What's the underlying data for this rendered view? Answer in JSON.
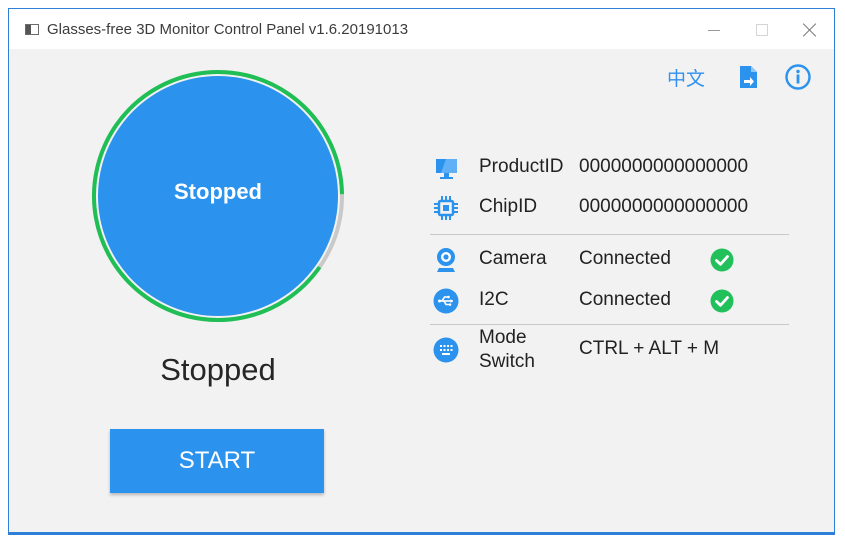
{
  "window": {
    "title": "Glasses-free 3D Monitor Control Panel v1.6.20191013"
  },
  "toolbar": {
    "language_label": "中文",
    "export_icon": "export-icon",
    "info_icon": "info-icon"
  },
  "status": {
    "circle_label": "Stopped",
    "text": "Stopped",
    "progress_ring_percent": 90
  },
  "actions": {
    "start_label": "START"
  },
  "device_info": {
    "product": {
      "icon": "monitor-icon",
      "label": "ProductID",
      "value": "0000000000000000"
    },
    "chip": {
      "icon": "chip-icon",
      "label": "ChipID",
      "value": "0000000000000000"
    },
    "camera": {
      "icon": "webcam-icon",
      "label": "Camera",
      "value": "Connected",
      "ok": true
    },
    "i2c": {
      "icon": "usb-icon",
      "label": "I2C",
      "value": "Connected",
      "ok": true
    },
    "mode": {
      "icon": "keyboard-icon",
      "label_line1": "Mode",
      "label_line2": "Switch",
      "value": "CTRL + ALT + M"
    }
  },
  "colors": {
    "accent": "#2b93ee",
    "progress_green": "#1fbf55",
    "ring_gray": "#c9c9c9",
    "check_green": "#21c05a"
  }
}
